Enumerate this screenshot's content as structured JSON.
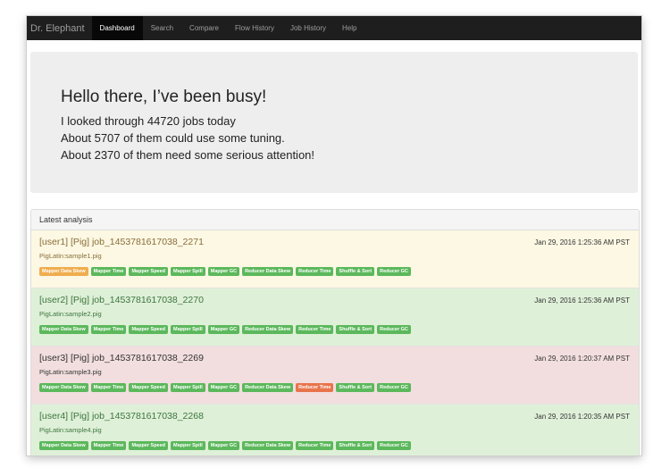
{
  "nav": {
    "brand": "Dr. Elephant",
    "items": [
      {
        "label": "Dashboard",
        "active": true
      },
      {
        "label": "Search",
        "active": false
      },
      {
        "label": "Compare",
        "active": false
      },
      {
        "label": "Flow History",
        "active": false
      },
      {
        "label": "Job History",
        "active": false
      },
      {
        "label": "Help",
        "active": false
      }
    ]
  },
  "hero": {
    "title": "Hello there, I’ve been busy!",
    "line1": "I looked through 44720 jobs today",
    "line2": "About 5707 of them could use some tuning.",
    "line3": "About 2370 of them need some serious attention!"
  },
  "panel": {
    "heading": "Latest analysis"
  },
  "jobs": [
    {
      "title": "[user1] [Pig] job_1453781617038_2271",
      "name": "PigLatin:sample1.pig",
      "time": "Jan 29, 2016 1:25:36 AM PST",
      "severity": "moderate",
      "labels": [
        {
          "text": "Mapper Data Skew",
          "status": "warn"
        },
        {
          "text": "Mapper Time",
          "status": "ok"
        },
        {
          "text": "Mapper Speed",
          "status": "ok"
        },
        {
          "text": "Mapper Spill",
          "status": "ok"
        },
        {
          "text": "Mapper GC",
          "status": "ok"
        },
        {
          "text": "Reducer Data Skew",
          "status": "ok"
        },
        {
          "text": "Reducer Time",
          "status": "ok"
        },
        {
          "text": "Shuffle & Sort",
          "status": "ok"
        },
        {
          "text": "Reducer GC",
          "status": "ok"
        }
      ]
    },
    {
      "title": "[user2] [Pig] job_1453781617038_2270",
      "name": "PigLatin:sample2.pig",
      "time": "Jan 29, 2016 1:25:36 AM PST",
      "severity": "none",
      "labels": [
        {
          "text": "Mapper Data Skew",
          "status": "ok"
        },
        {
          "text": "Mapper Time",
          "status": "ok"
        },
        {
          "text": "Mapper Speed",
          "status": "ok"
        },
        {
          "text": "Mapper Spill",
          "status": "ok"
        },
        {
          "text": "Mapper GC",
          "status": "ok"
        },
        {
          "text": "Reducer Data Skew",
          "status": "ok"
        },
        {
          "text": "Reducer Time",
          "status": "ok"
        },
        {
          "text": "Shuffle & Sort",
          "status": "ok"
        },
        {
          "text": "Reducer GC",
          "status": "ok"
        }
      ]
    },
    {
      "title": "[user3] [Pig] job_1453781617038_2269",
      "name": "PigLatin:sample3.pig",
      "time": "Jan 29, 2016 1:20:37 AM PST",
      "severity": "severe",
      "labels": [
        {
          "text": "Mapper Data Skew",
          "status": "ok"
        },
        {
          "text": "Mapper Time",
          "status": "ok"
        },
        {
          "text": "Mapper Speed",
          "status": "ok"
        },
        {
          "text": "Mapper Spill",
          "status": "ok"
        },
        {
          "text": "Mapper GC",
          "status": "ok"
        },
        {
          "text": "Reducer Data Skew",
          "status": "ok"
        },
        {
          "text": "Reducer Time",
          "status": "danger"
        },
        {
          "text": "Shuffle & Sort",
          "status": "ok"
        },
        {
          "text": "Reducer GC",
          "status": "ok"
        }
      ]
    },
    {
      "title": "[user4] [Pig] job_1453781617038_2268",
      "name": "PigLatin:sample4.pig",
      "time": "Jan 29, 2016 1:20:35 AM PST",
      "severity": "none",
      "labels": [
        {
          "text": "Mapper Data Skew",
          "status": "ok"
        },
        {
          "text": "Mapper Time",
          "status": "ok"
        },
        {
          "text": "Mapper Speed",
          "status": "ok"
        },
        {
          "text": "Mapper Spill",
          "status": "ok"
        },
        {
          "text": "Mapper GC",
          "status": "ok"
        },
        {
          "text": "Reducer Data Skew",
          "status": "ok"
        },
        {
          "text": "Reducer Time",
          "status": "ok"
        },
        {
          "text": "Shuffle & Sort",
          "status": "ok"
        },
        {
          "text": "Reducer GC",
          "status": "ok"
        }
      ]
    }
  ]
}
